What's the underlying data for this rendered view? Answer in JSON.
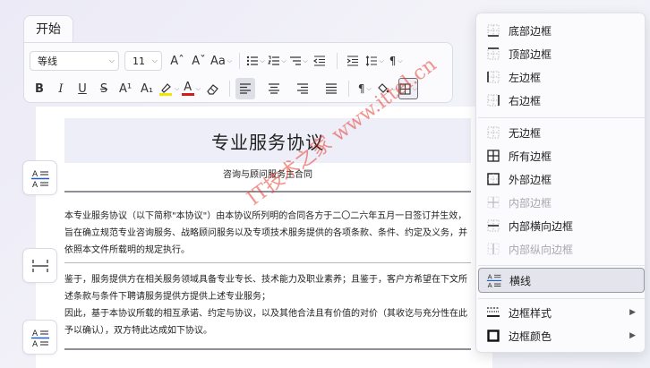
{
  "ribbon": {
    "tab_label": "开始",
    "font_name": "等线",
    "font_size": "11",
    "grow_font": "Aˆ",
    "shrink_font": "Aˇ",
    "change_case": "Aa",
    "bold": "B",
    "italic": "I",
    "underline": "U",
    "strike": "S",
    "superscript": "A¹",
    "subscript": "A₁",
    "font_color_glyph": "A"
  },
  "document": {
    "title": "专业服务协议",
    "subtitle": "咨询与顾问服务主合同",
    "para1": "本专业服务协议（以下简称\"本协议\"）由本协议所列明的合同各方于二〇二六年五月一日签订并生效，旨在确立规范专业咨询服务、战略顾问服务以及专项技术服务提供的各项条款、条件、约定及义务，并依照本文件所载明的规定执行。",
    "para2": "鉴于，服务提供方在相关服务领域具备专业专长、技术能力及职业素养；且鉴于，客户方希望在下文所述条款与条件下聘请服务提供方提供上述专业服务；",
    "para3": "因此，基于本协议所载的相互承诺、约定与协议，以及其他合法且有价值的对价（其收讫与充分性在此予以确认），双方特此达成如下协议。"
  },
  "watermark": "IT技术之家 www.ittel.cn",
  "border_menu": {
    "items": [
      {
        "label": "底部边框",
        "icon": "border-bottom-icon",
        "disabled": false
      },
      {
        "label": "顶部边框",
        "icon": "border-top-icon",
        "disabled": false
      },
      {
        "label": "左边框",
        "icon": "border-left-icon",
        "disabled": false
      },
      {
        "label": "右边框",
        "icon": "border-right-icon",
        "disabled": false
      },
      {
        "label": "无边框",
        "icon": "border-none-icon",
        "disabled": false
      },
      {
        "label": "所有边框",
        "icon": "border-all-icon",
        "disabled": false
      },
      {
        "label": "外部边框",
        "icon": "border-outside-icon",
        "disabled": false
      },
      {
        "label": "内部边框",
        "icon": "border-inside-icon",
        "disabled": true
      },
      {
        "label": "内部横向边框",
        "icon": "border-inside-horizontal-icon",
        "disabled": false
      },
      {
        "label": "内部纵向边框",
        "icon": "border-inside-vertical-icon",
        "disabled": true
      },
      {
        "label": "横线",
        "icon": "horizontal-line-icon",
        "disabled": false,
        "highlighted": true
      },
      {
        "label": "边框样式",
        "icon": "border-style-icon",
        "disabled": false,
        "submenu": true
      },
      {
        "label": "边框颜色",
        "icon": "border-color-icon",
        "disabled": false,
        "submenu": true
      }
    ]
  },
  "colors": {
    "highlight_yellow": "#f2e600",
    "font_color_red": "#d21c1c",
    "watermark_red": "#e63c2d"
  }
}
